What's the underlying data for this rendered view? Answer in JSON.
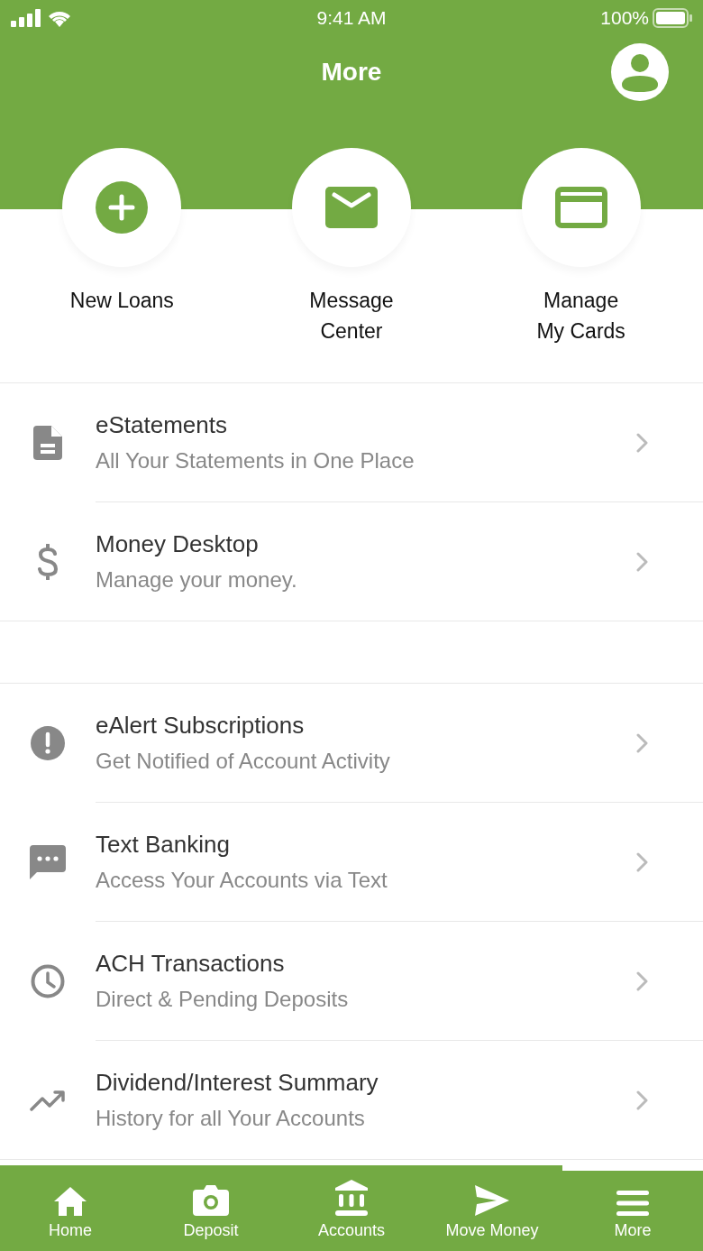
{
  "status_bar": {
    "time": "9:41 AM",
    "battery": "100%"
  },
  "header": {
    "title": "More"
  },
  "actions": [
    {
      "label": "New Loans"
    },
    {
      "label": "Message\nCenter"
    },
    {
      "label": "Manage\nMy Cards"
    }
  ],
  "sections": [
    {
      "items": [
        {
          "title": "eStatements",
          "subtitle": "All Your Statements in One Place"
        },
        {
          "title": "Money Desktop",
          "subtitle": "Manage your money."
        }
      ]
    },
    {
      "items": [
        {
          "title": "eAlert Subscriptions",
          "subtitle": "Get Notified of Account Activity"
        },
        {
          "title": "Text Banking",
          "subtitle": "Access Your Accounts via Text"
        },
        {
          "title": "ACH Transactions",
          "subtitle": "Direct & Pending Deposits"
        },
        {
          "title": "Dividend/Interest Summary",
          "subtitle": "History for all Your Accounts"
        }
      ]
    }
  ],
  "tabs": [
    {
      "label": "Home",
      "selected": false
    },
    {
      "label": "Deposit",
      "selected": false
    },
    {
      "label": "Accounts",
      "selected": false
    },
    {
      "label": "Move Money",
      "selected": false
    },
    {
      "label": "More",
      "selected": true
    }
  ]
}
